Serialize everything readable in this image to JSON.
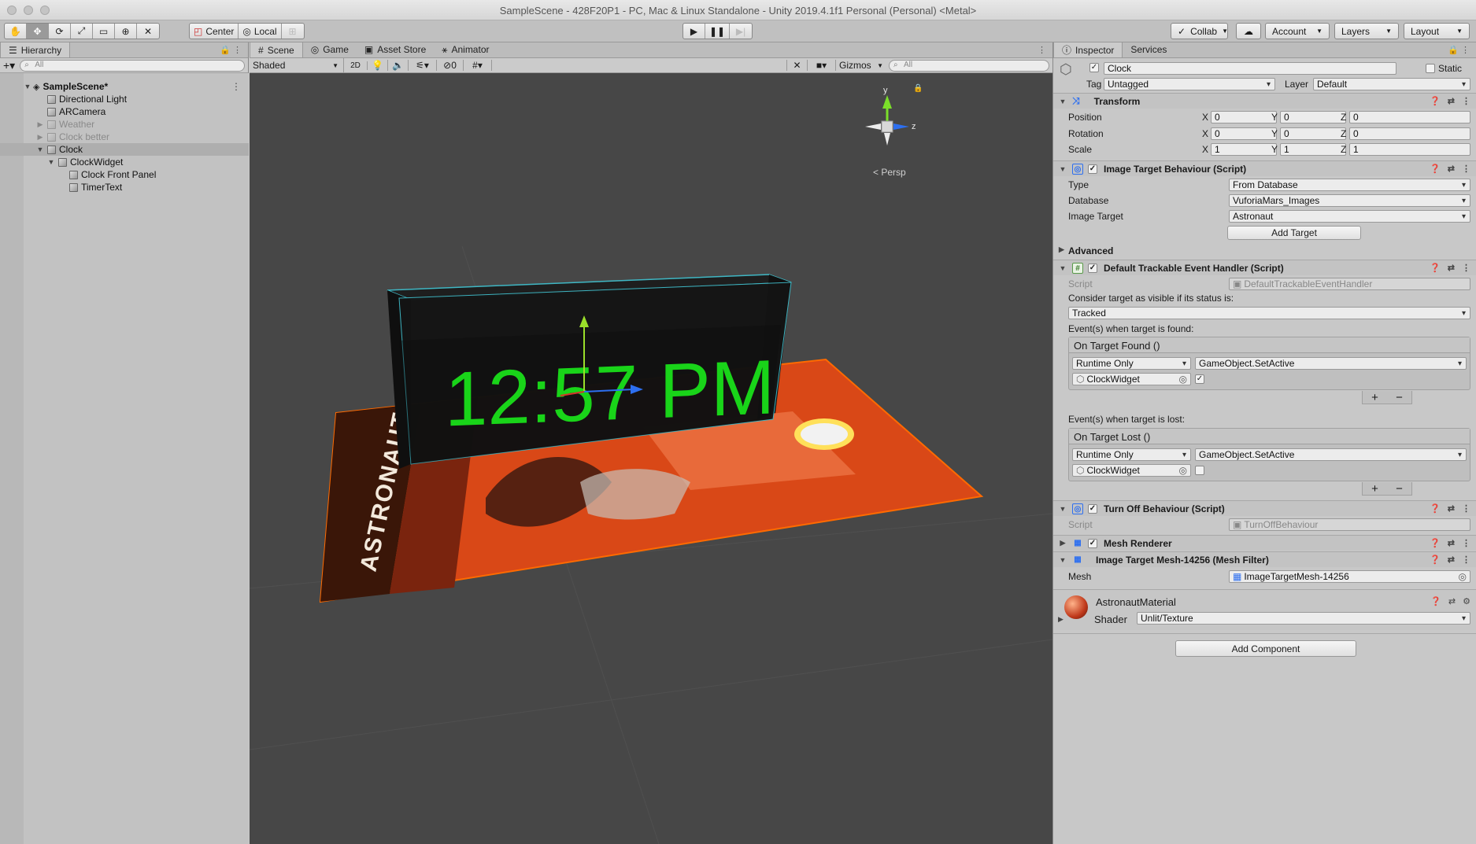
{
  "window": {
    "title": "SampleScene - 428F20P1 - PC, Mac & Linux Standalone - Unity 2019.4.1f1 Personal (Personal) <Metal>"
  },
  "toolbar": {
    "pivot_label": "Center",
    "space_label": "Local",
    "collab_label": "Collab",
    "account_label": "Account",
    "layers_label": "Layers",
    "layout_label": "Layout"
  },
  "hierarchy": {
    "tab_label": "Hierarchy",
    "search_placeholder": "All",
    "items": [
      {
        "label": "SampleScene*"
      },
      {
        "label": "Directional Light"
      },
      {
        "label": "ARCamera"
      },
      {
        "label": "Weather"
      },
      {
        "label": "Clock better"
      },
      {
        "label": "Clock"
      },
      {
        "label": "ClockWidget"
      },
      {
        "label": "Clock Front Panel"
      },
      {
        "label": "TimerText"
      }
    ]
  },
  "scene": {
    "tabs": [
      {
        "label": "Scene"
      },
      {
        "label": "Game"
      },
      {
        "label": "Asset Store"
      },
      {
        "label": "Animator"
      }
    ],
    "shading_mode": "Shaded",
    "mode_2d": "2D",
    "hidden_count": "0",
    "gizmos_label": "Gizmos",
    "search_placeholder": "All",
    "clock_text": "12:57 PM",
    "poster_text": "ASTRONAUT",
    "persp_label": "Persp",
    "axis_y": "y",
    "axis_z": "z"
  },
  "inspector": {
    "tabs": [
      {
        "label": "Inspector"
      },
      {
        "label": "Services"
      }
    ],
    "object_name": "Clock",
    "static_label": "Static",
    "tag_label": "Tag",
    "tag_value": "Untagged",
    "layer_label": "Layer",
    "layer_value": "Default",
    "transform": {
      "title": "Transform",
      "position_label": "Position",
      "rotation_label": "Rotation",
      "scale_label": "Scale",
      "axis_x": "X",
      "axis_y": "Y",
      "axis_z": "Z",
      "position": [
        "0",
        "0",
        "0"
      ],
      "rotation": [
        "0",
        "0",
        "0"
      ],
      "scale": [
        "1",
        "1",
        "1"
      ]
    },
    "image_target": {
      "title": "Image Target Behaviour (Script)",
      "type_label": "Type",
      "type_value": "From Database",
      "database_label": "Database",
      "database_value": "VuforiaMars_Images",
      "image_target_label": "Image Target",
      "image_target_value": "Astronaut",
      "add_target_label": "Add Target"
    },
    "advanced_label": "Advanced",
    "trackable": {
      "title": "Default Trackable Event Handler (Script)",
      "script_label": "Script",
      "script_value": "DefaultTrackableEventHandler",
      "consider_label": "Consider target as visible if its status is:",
      "status_value": "Tracked",
      "found_label": "Event(s) when target is found:",
      "found_event": "On Target Found ()",
      "lost_label": "Event(s) when target is lost:",
      "lost_event": "On Target Lost ()",
      "runtime_label": "Runtime Only",
      "function_label": "GameObject.SetActive",
      "target_object": "ClockWidget",
      "plus": "+",
      "minus": "−"
    },
    "turn_off": {
      "title": "Turn Off Behaviour (Script)",
      "script_label": "Script",
      "script_value": "TurnOffBehaviour"
    },
    "mesh_renderer": {
      "title": "Mesh Renderer"
    },
    "mesh_filter": {
      "title": "Image Target Mesh-14256 (Mesh Filter)",
      "mesh_label": "Mesh",
      "mesh_value": "ImageTargetMesh-14256"
    },
    "material": {
      "name": "AstronautMaterial",
      "shader_label": "Shader",
      "shader_value": "Unlit/Texture"
    },
    "add_component_label": "Add Component"
  },
  "colors": {
    "clock_digits": "#19d419",
    "selection_outline": "#ff6a00",
    "poster_orange": "#e8521a"
  }
}
